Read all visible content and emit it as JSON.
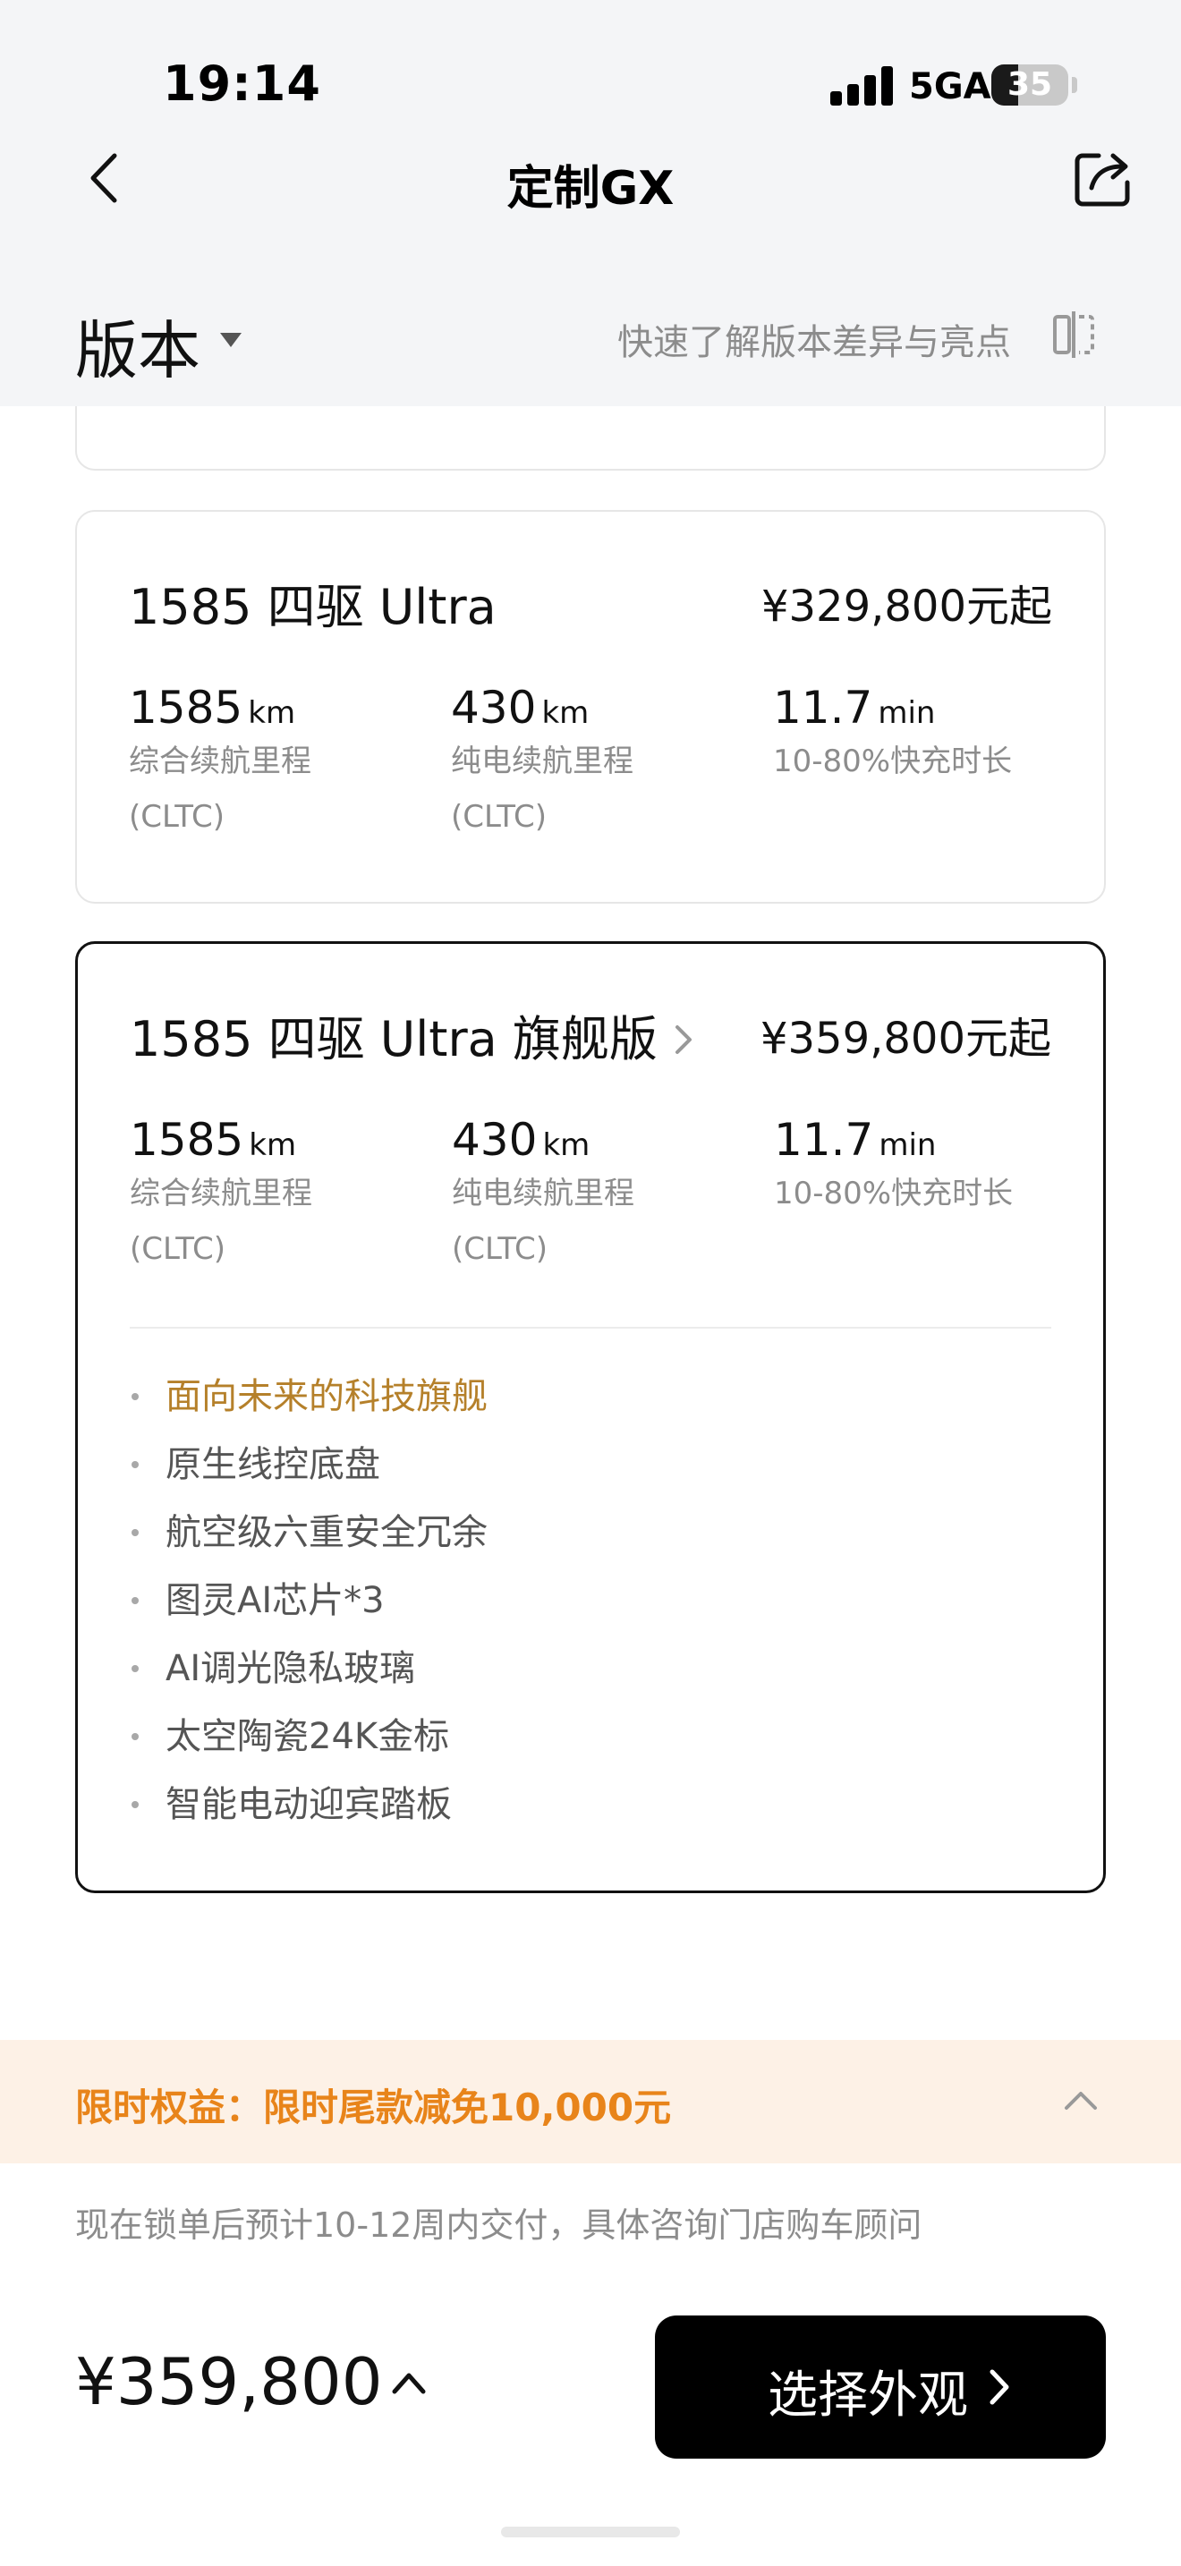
{
  "status_bar": {
    "time": "19:14",
    "network": "5GA",
    "battery_level": "35"
  },
  "nav": {
    "title": "定制GX",
    "back_icon": "chevron-left-icon",
    "share_icon": "share-icon"
  },
  "version_bar": {
    "title": "版本",
    "compare_link": "快速了解版本差异与亮点",
    "compare_icon": "compare-split-icon"
  },
  "trims": [
    {
      "name": "1585 四驱 Ultra",
      "price": "¥329,800元起",
      "selected": false,
      "specs": [
        {
          "value": "1585",
          "unit": "km",
          "label": "综合续航里程",
          "sub": "(CLTC)"
        },
        {
          "value": "430",
          "unit": "km",
          "label": "纯电续航里程",
          "sub": "(CLTC)"
        },
        {
          "value": "11.7",
          "unit": "min",
          "label": "10-80%快充时长",
          "sub": ""
        }
      ]
    },
    {
      "name": "1585 四驱 Ultra 旗舰版",
      "price": "¥359,800元起",
      "selected": true,
      "specs": [
        {
          "value": "1585",
          "unit": "km",
          "label": "综合续航里程",
          "sub": "(CLTC)"
        },
        {
          "value": "430",
          "unit": "km",
          "label": "纯电续航里程",
          "sub": "(CLTC)"
        },
        {
          "value": "11.7",
          "unit": "min",
          "label": "10-80%快充时长",
          "sub": ""
        }
      ],
      "features": [
        "面向未来的科技旗舰",
        "原生线控底盘",
        "航空级六重安全冗余",
        "图灵AI芯片*3",
        "AI调光隐私玻璃",
        "太空陶瓷24K金标",
        "智能电动迎宾踏板"
      ]
    }
  ],
  "promo": {
    "text": "限时权益：限时尾款减免10,000元"
  },
  "delivery_note": "现在锁单后预计10-12周内交付，具体咨询门店购车顾问",
  "footer": {
    "total_price": "¥359,800",
    "cta_label": "选择外观"
  },
  "colors": {
    "promo_text": "#e8841a",
    "promo_bg": "#fdf1e6",
    "feature_highlight": "#b5802a",
    "cta_bg": "#000000"
  }
}
